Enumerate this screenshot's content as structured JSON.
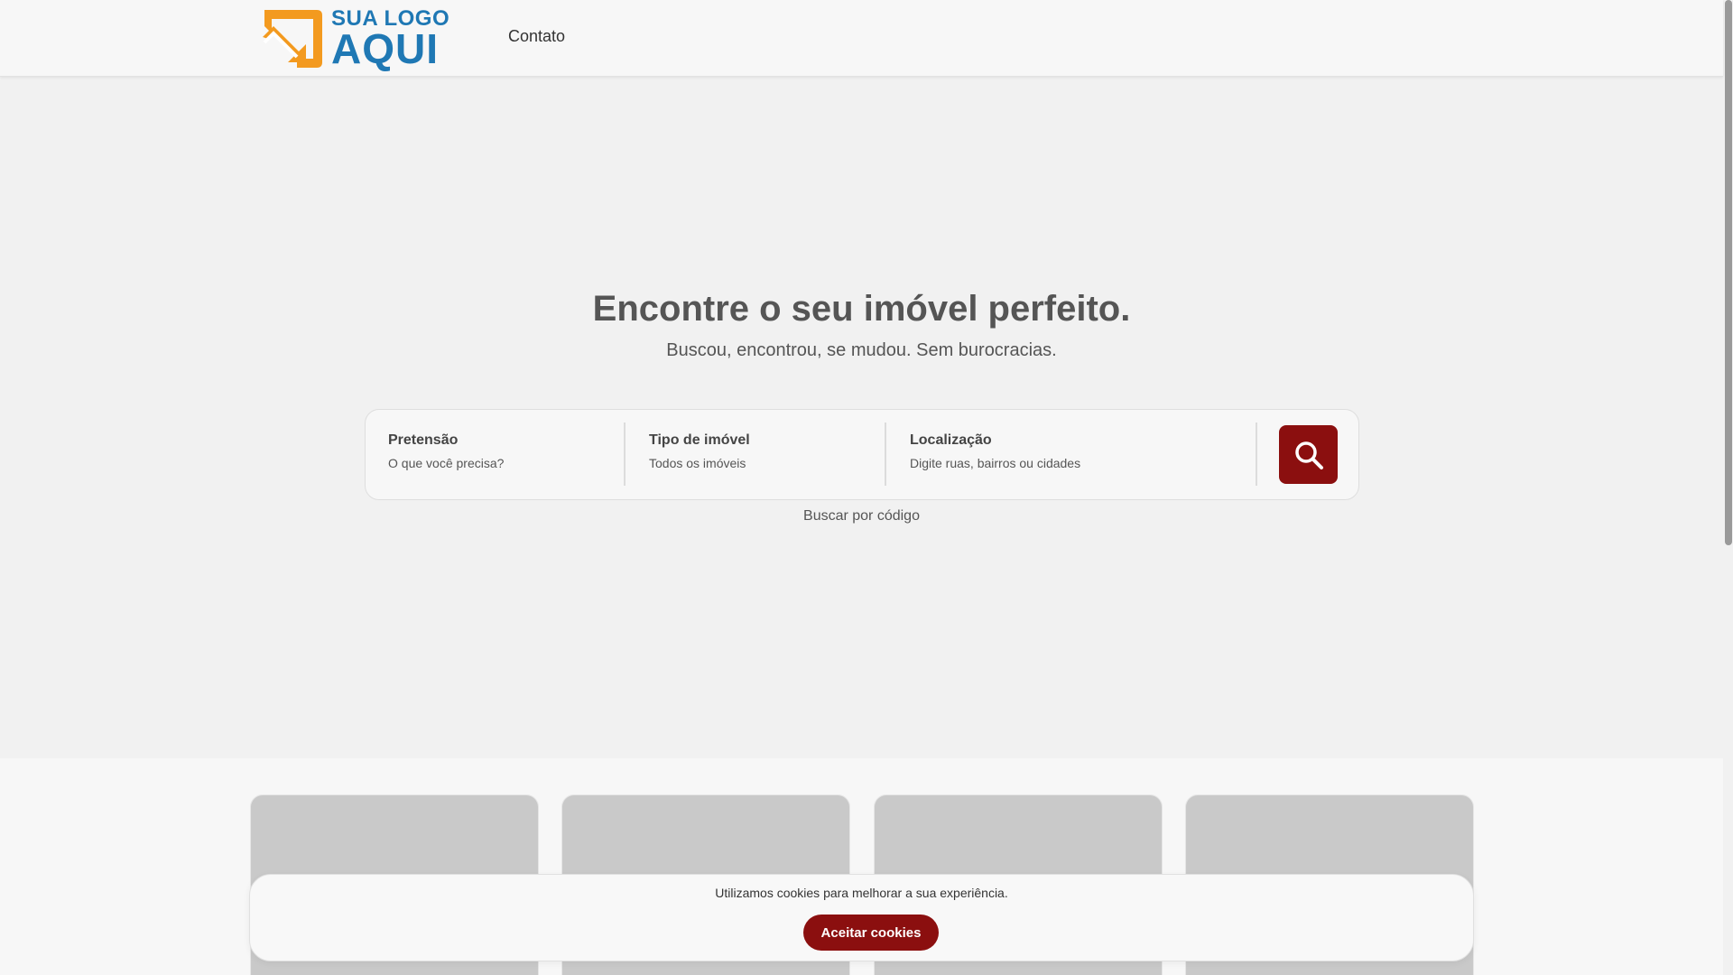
{
  "header": {
    "logo_top": "SUA LOGO",
    "logo_bottom": "AQUI",
    "nav_contato": "Contato"
  },
  "hero": {
    "title": "Encontre o seu imóvel perfeito.",
    "subtitle": "Buscou, encontrou, se mudou. Sem burocracias.",
    "buscar_codigo": "Buscar por código"
  },
  "search": {
    "fields": [
      {
        "label": "Pretensão",
        "value": "O que você precisa?"
      },
      {
        "label": "Tipo de imóvel",
        "value": "Todos os imóveis"
      },
      {
        "label": "Localização",
        "value": "Digite ruas, bairros ou cidades"
      }
    ],
    "button_icon": "search-icon"
  },
  "cookie": {
    "text": "Utilizamos cookies para melhorar a sua experiência.",
    "button": "Aceitar cookies"
  },
  "colors": {
    "accent": "#8b0f0f",
    "logo_orange": "#f39a1f",
    "logo_blue": "#1f78b4"
  }
}
